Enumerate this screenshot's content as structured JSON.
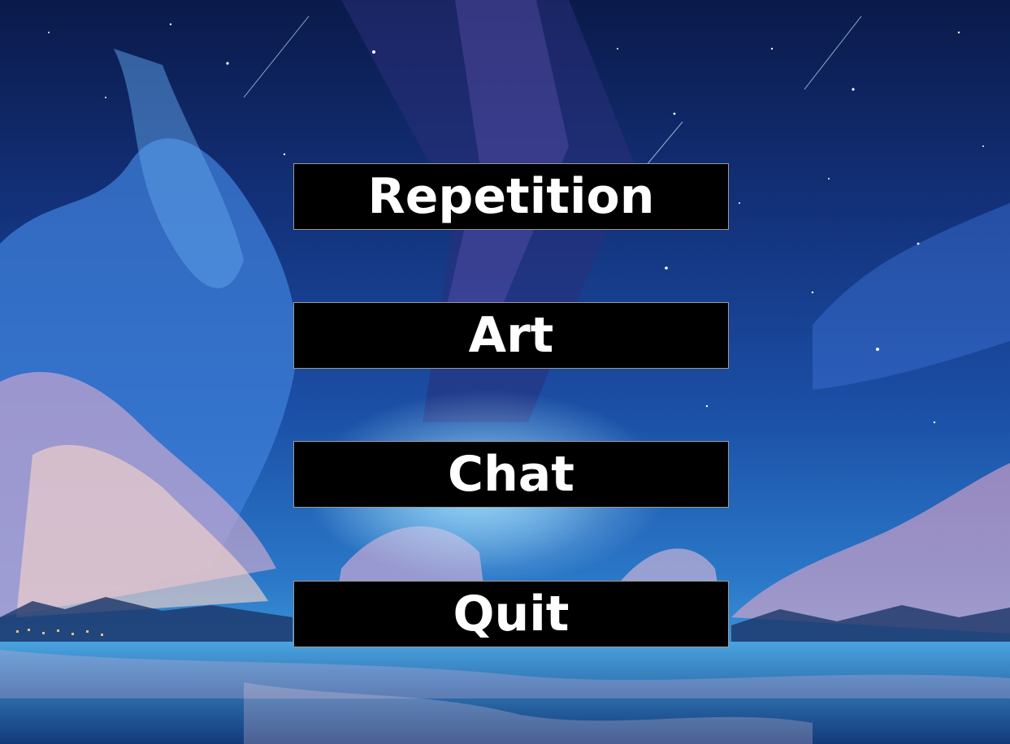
{
  "menu": {
    "items": [
      {
        "label": "Repetition"
      },
      {
        "label": "Art"
      },
      {
        "label": "Chat"
      },
      {
        "label": "Quit"
      }
    ]
  },
  "colors": {
    "button_bg": "#000000",
    "button_text": "#ffffff",
    "sky_top": "#0a1a4a",
    "sky_mid": "#1b4fa6",
    "horizon": "#3a8fd6"
  }
}
